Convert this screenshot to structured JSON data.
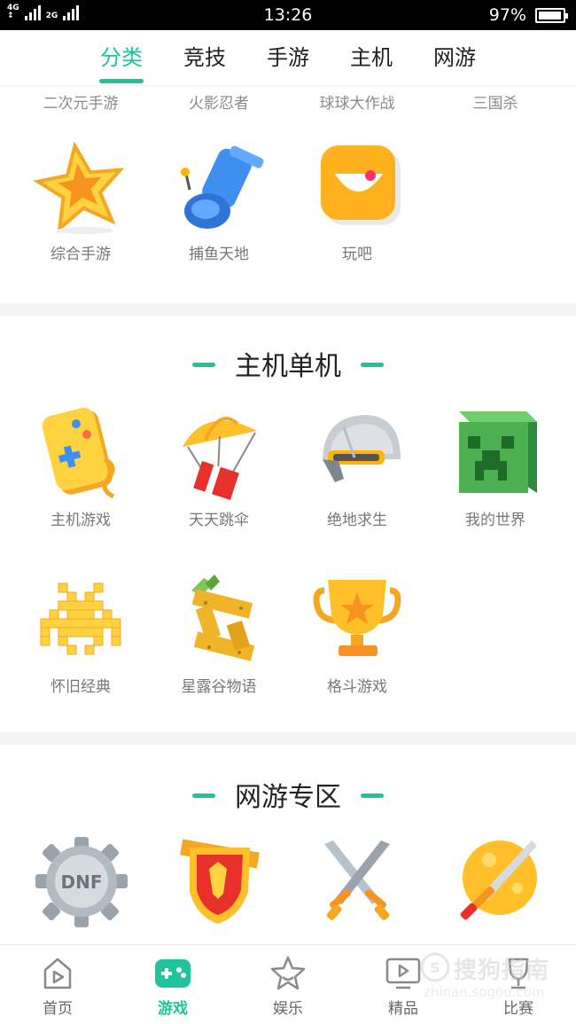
{
  "status_bar": {
    "network": "4G 4G 2G",
    "time": "13:26",
    "battery": "97%",
    "battery_level": 0.97
  },
  "top_tabs": [
    {
      "label": "分类",
      "active": true
    },
    {
      "label": "竞技",
      "active": false
    },
    {
      "label": "手游",
      "active": false
    },
    {
      "label": "主机",
      "active": false
    },
    {
      "label": "网游",
      "active": false
    }
  ],
  "mobile_section": {
    "cut_off_labels": [
      "二次元手游",
      "火影忍者",
      "球球大作战",
      "三国杀"
    ],
    "items": [
      {
        "label": "综合手游",
        "icon": "star-icon"
      },
      {
        "label": "捕鱼天地",
        "icon": "cannon-icon"
      },
      {
        "label": "玩吧",
        "icon": "wanba-face-icon"
      }
    ]
  },
  "console_section": {
    "title": "主机单机",
    "items": [
      {
        "label": "主机游戏",
        "icon": "gamepad-icon"
      },
      {
        "label": "天天跳伞",
        "icon": "parachute-icon"
      },
      {
        "label": "绝地求生",
        "icon": "helmet-icon"
      },
      {
        "label": "我的世界",
        "icon": "creeper-block-icon"
      },
      {
        "label": "怀旧经典",
        "icon": "space-invader-icon"
      },
      {
        "label": "星露谷物语",
        "icon": "wooden-s-icon"
      },
      {
        "label": "格斗游戏",
        "icon": "trophy-icon"
      }
    ]
  },
  "online_section": {
    "title": "网游专区",
    "items": [
      {
        "label": "",
        "icon": "dnf-gear-icon"
      },
      {
        "label": "",
        "icon": "horde-shield-icon"
      },
      {
        "label": "",
        "icon": "crossed-swords-icon"
      },
      {
        "label": "",
        "icon": "sword-moon-icon"
      }
    ]
  },
  "bottom_nav": [
    {
      "label": "首页",
      "icon": "home-play-icon",
      "active": false
    },
    {
      "label": "游戏",
      "icon": "gamepad-nav-icon",
      "active": true
    },
    {
      "label": "娱乐",
      "icon": "star-nav-icon",
      "active": false
    },
    {
      "label": "精品",
      "icon": "monitor-play-icon",
      "active": false
    },
    {
      "label": "比赛",
      "icon": "trophy-nav-icon",
      "active": false
    }
  ],
  "watermark": {
    "text": "搜狗指南",
    "url_text": "zhinan.sogou.com"
  },
  "colors": {
    "accent": "#1fc49a",
    "text": "#222222",
    "muted": "#777777"
  }
}
